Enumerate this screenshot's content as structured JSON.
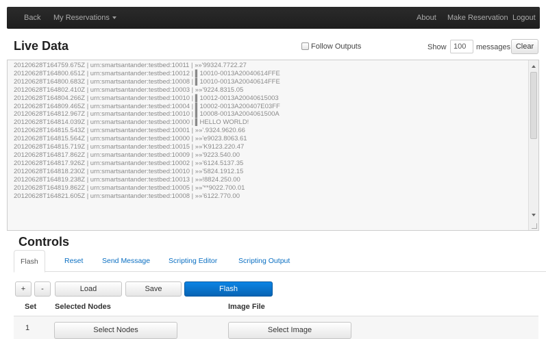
{
  "navbar": {
    "back": "Back",
    "reservations": "My Reservations",
    "about": "About",
    "make_reservation": "Make Reservation",
    "logout": "Logout"
  },
  "live_data": {
    "title": "Live Data",
    "follow_label": "Follow Outputs",
    "show_label": "Show",
    "message_count": "100",
    "messages_label": "messages",
    "clear_label": "Clear",
    "log_lines": [
      "20120628T164759.675Z | urn:smartsantander:testbed:10011 | »»'99324.7722.27",
      "20120628T164800.651Z | urn:smartsantander:testbed:10012 | ▌10010-0013A20040614FFE",
      "20120628T164800.683Z | urn:smartsantander:testbed:10008 | ▌10010-0013A20040614FFE",
      "20120628T164802.410Z | urn:smartsantander:testbed:10003 | »»'9224.8315.05",
      "20120628T164804.266Z | urn:smartsantander:testbed:10010 | ▌10012-0013A20040615003",
      "20120628T164809.465Z | urn:smartsantander:testbed:10004 | ▌10002-0013A200407E03FF",
      "20120628T164812.967Z | urn:smartsantander:testbed:10010 | ▌10008-0013A2004061500A",
      "20120628T164814.039Z | urn:smartsantander:testbed:10000 | ▌HELLO WORLD!",
      "20120628T164815.543Z | urn:smartsantander:testbed:10001 | »»'.9324.9620.66",
      "20120628T164815.564Z | urn:smartsantander:testbed:10000 | »»'e9023.8063.61",
      "20120628T164815.719Z | urn:smartsantander:testbed:10015 | »»'K9123.220.47",
      "20120628T164817.862Z | urn:smartsantander:testbed:10009 | »»'9223.540.00",
      "20120628T164817.926Z | urn:smartsantander:testbed:10002 | »»'6124.5137.35",
      "20120628T164818.230Z | urn:smartsantander:testbed:10010 | »»'5824.1912.15",
      "20120628T164819.238Z | urn:smartsantander:testbed:10013 | »»!8824.250.00",
      "20120628T164819.862Z | urn:smartsantander:testbed:10005 | »»'**9022.700.01",
      "20120628T164821.605Z | urn:smartsantander:testbed:10008 | »»'6122.770.00"
    ]
  },
  "controls": {
    "title": "Controls",
    "tabs": [
      "Flash",
      "Reset",
      "Send Message",
      "Scripting Editor",
      "Scripting Output"
    ],
    "buttons": {
      "add": "+",
      "remove": "-",
      "load": "Load",
      "save": "Save",
      "flash": "Flash"
    },
    "table": {
      "headers": [
        "Set",
        "Selected Nodes",
        "Image File"
      ],
      "rows": [
        {
          "set": "1",
          "select_nodes": "Select Nodes",
          "select_image": "Select Image"
        }
      ]
    }
  }
}
